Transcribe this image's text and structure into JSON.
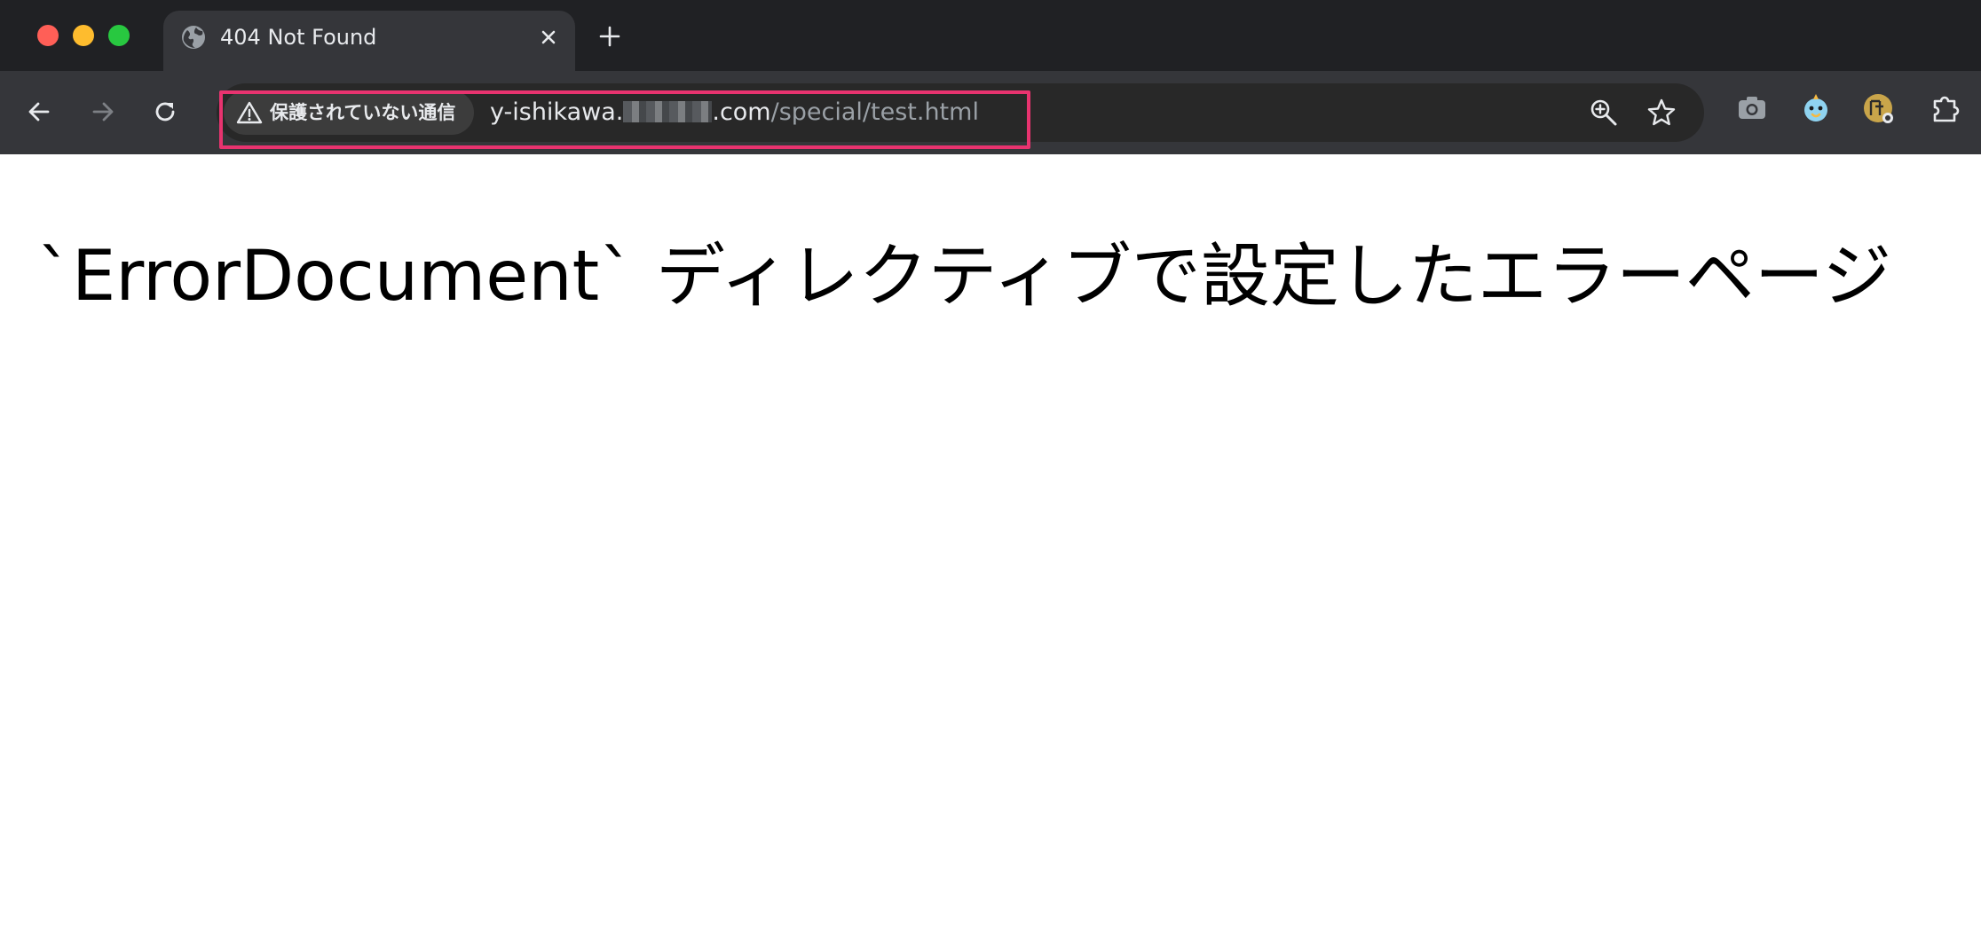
{
  "window": {
    "controls": [
      "close",
      "minimize",
      "maximize"
    ]
  },
  "tab": {
    "title": "404 Not Found",
    "favicon": "globe-icon",
    "close_icon": "close-icon"
  },
  "new_tab_icon": "plus-icon",
  "toolbar": {
    "back_icon": "back-arrow-icon",
    "forward_icon": "forward-arrow-icon",
    "reload_icon": "reload-icon"
  },
  "address_bar": {
    "security_label": "保護されていない通信",
    "security_icon": "warning-triangle-icon",
    "url_host_start": "y-ishikawa.",
    "url_host_end": ".com",
    "url_path": "/special/test.html",
    "zoom_icon": "zoom-in-icon",
    "bookmark_icon": "star-icon"
  },
  "extensions": [
    "camera-icon",
    "bird-icon",
    "gold-circle-icon",
    "puzzle-icon"
  ],
  "page": {
    "heading": "`ErrorDocument` ディレクティブで設定したエラーページ"
  },
  "colors": {
    "tabstrip_bg": "#202124",
    "toolbar_bg": "#35363a",
    "omnibox_bg": "#282828",
    "highlight": "#e8336f"
  }
}
